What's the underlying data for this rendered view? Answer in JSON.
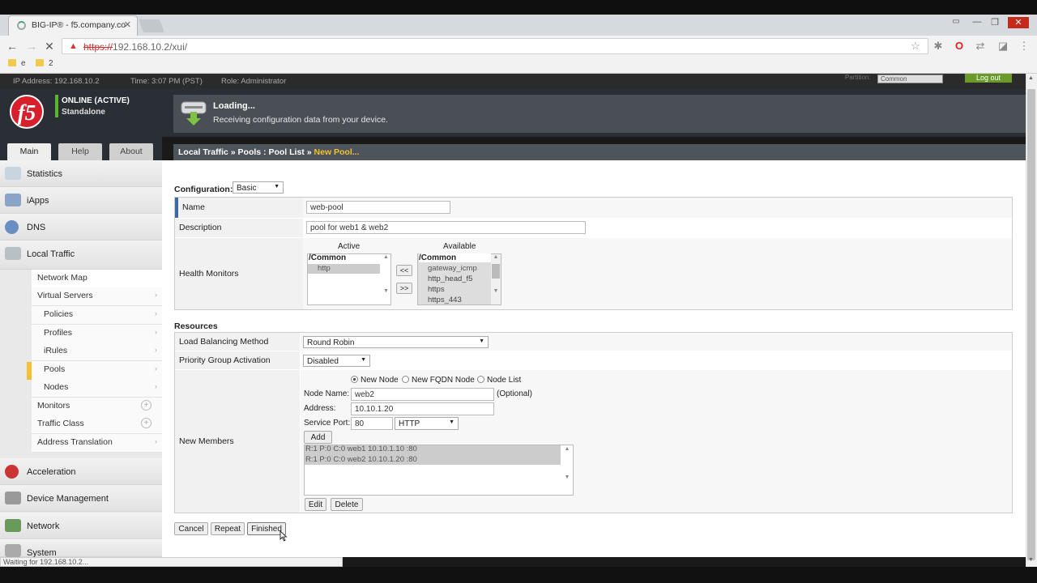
{
  "browser": {
    "tab_title": "BIG-IP® - f5.company.co",
    "url_scheme": "https://",
    "url_rest": "192.168.10.2/xui/",
    "bookmarks": [
      "e",
      "2"
    ],
    "status_text": "Waiting for 192.168.10.2..."
  },
  "header": {
    "ip": "IP Address: 192.168.10.2",
    "time": "Time: 3:07 PM (PST)",
    "role": "Role: Administrator",
    "partition_label": "Partition:",
    "partition_value": "Common",
    "logout": "Log out",
    "logo_text": "f5",
    "status_line1": "ONLINE (ACTIVE)",
    "status_line2": "Standalone",
    "loading_title": "Loading...",
    "loading_msg": "Receiving configuration data from your device."
  },
  "tabs": [
    "Main",
    "Help",
    "About"
  ],
  "breadcrumb": {
    "part1": "Local Traffic",
    "sep": " » ",
    "part2": "Pools : Pool List",
    "current": "New Pool..."
  },
  "sidebar": {
    "groups": [
      "Statistics",
      "iApps",
      "DNS",
      "Local Traffic"
    ],
    "items": [
      "Network Map",
      "Virtual Servers",
      "Policies",
      "Profiles",
      "iRules",
      "Pools",
      "Nodes",
      "Monitors",
      "Traffic Class",
      "Address Translation"
    ],
    "groups_bottom": [
      "Acceleration",
      "Device Management",
      "Network",
      "System"
    ]
  },
  "form": {
    "config_label": "Configuration:",
    "config_value": "Basic",
    "name_label": "Name",
    "name_value": "web-pool",
    "desc_label": "Description",
    "desc_value": "pool for web1 & web2",
    "health_label": "Health Monitors",
    "active_label": "Active",
    "available_label": "Available",
    "active_header": "/Common",
    "active_items": [
      "http"
    ],
    "available_header": "/Common",
    "available_items": [
      "gateway_icmp",
      "http_head_f5",
      "https",
      "https_443"
    ],
    "move_left": "<<",
    "move_right": ">>",
    "resources_label": "Resources",
    "lb_label": "Load Balancing Method",
    "lb_value": "Round Robin",
    "pga_label": "Priority Group Activation",
    "pga_value": "Disabled",
    "members_label": "New Members",
    "radio_new_node": "New Node",
    "radio_fqdn": "New FQDN Node",
    "radio_list": "Node List",
    "node_name_label": "Node Name:",
    "node_name_value": "web2",
    "optional": "(Optional)",
    "address_label": "Address:",
    "address_value": "10.10.1.20",
    "port_label": "Service Port:",
    "port_value": "80",
    "port_service": "HTTP",
    "add_btn": "Add",
    "members": [
      "R:1 P:0 C:0 web1 10.10.1.10 :80",
      "R:1 P:0 C:0 web2 10.10.1.20 :80"
    ],
    "edit_btn": "Edit",
    "delete_btn": "Delete",
    "cancel_btn": "Cancel",
    "repeat_btn": "Repeat",
    "finished_btn": "Finished"
  },
  "colors": {
    "f5_red": "#d8202c",
    "online_green": "#5cb52e",
    "breadcrumb_current": "#f2c030",
    "logout_green": "#6a9a2a"
  }
}
